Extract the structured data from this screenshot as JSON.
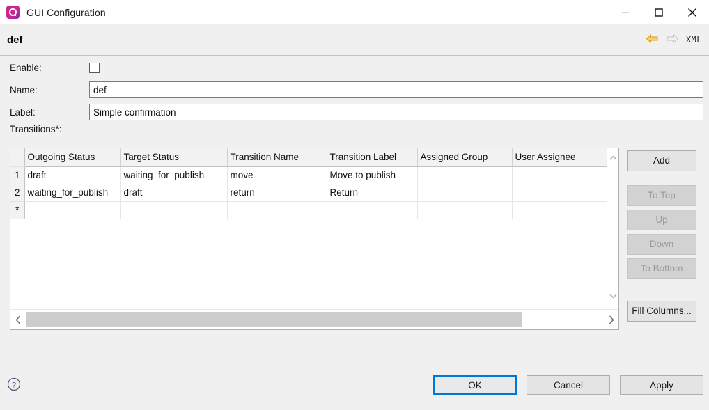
{
  "window": {
    "title": "GUI Configuration",
    "icon": "app-logo-icon",
    "controls": {
      "minimize": "minimize-icon",
      "maximize": "maximize-icon",
      "close": "close-icon"
    }
  },
  "header": {
    "title": "def",
    "back_icon": "back-arrow-icon",
    "forward_icon": "forward-arrow-icon",
    "xml_label": "XML",
    "back_color": "#e0a520",
    "forward_color": "#c9c9c9"
  },
  "form": {
    "enable": {
      "label": "Enable:",
      "checked": false
    },
    "name": {
      "label": "Name:",
      "value": "def",
      "placeholder": ""
    },
    "label": {
      "label": "Label:",
      "value": "Simple confirmation",
      "placeholder": ""
    },
    "transitions": {
      "label": "Transitions*:"
    }
  },
  "table": {
    "columns": [
      "Outgoing Status",
      "Target Status",
      "Transition Name",
      "Transition Label",
      "Assigned Group",
      "User Assignee"
    ],
    "rows": [
      {
        "num": "1",
        "cells": [
          "draft",
          "waiting_for_publish",
          "move",
          "Move to publish",
          "",
          ""
        ]
      },
      {
        "num": "2",
        "cells": [
          "waiting_for_publish",
          "draft",
          "return",
          "Return",
          "",
          ""
        ]
      },
      {
        "num": "*",
        "cells": [
          "",
          "",
          "",
          "",
          "",
          ""
        ]
      }
    ]
  },
  "side_buttons": [
    {
      "label": "Add",
      "enabled": true
    },
    {
      "label": "To Top",
      "enabled": false
    },
    {
      "label": "Up",
      "enabled": false
    },
    {
      "label": "Down",
      "enabled": false
    },
    {
      "label": "To Bottom",
      "enabled": false
    },
    {
      "label": "Fill Columns...",
      "enabled": true
    }
  ],
  "footer": {
    "help_icon": "help-icon",
    "ok": "OK",
    "cancel": "Cancel",
    "apply": "Apply",
    "default_button": "OK",
    "focus_color": "#0078d7"
  }
}
